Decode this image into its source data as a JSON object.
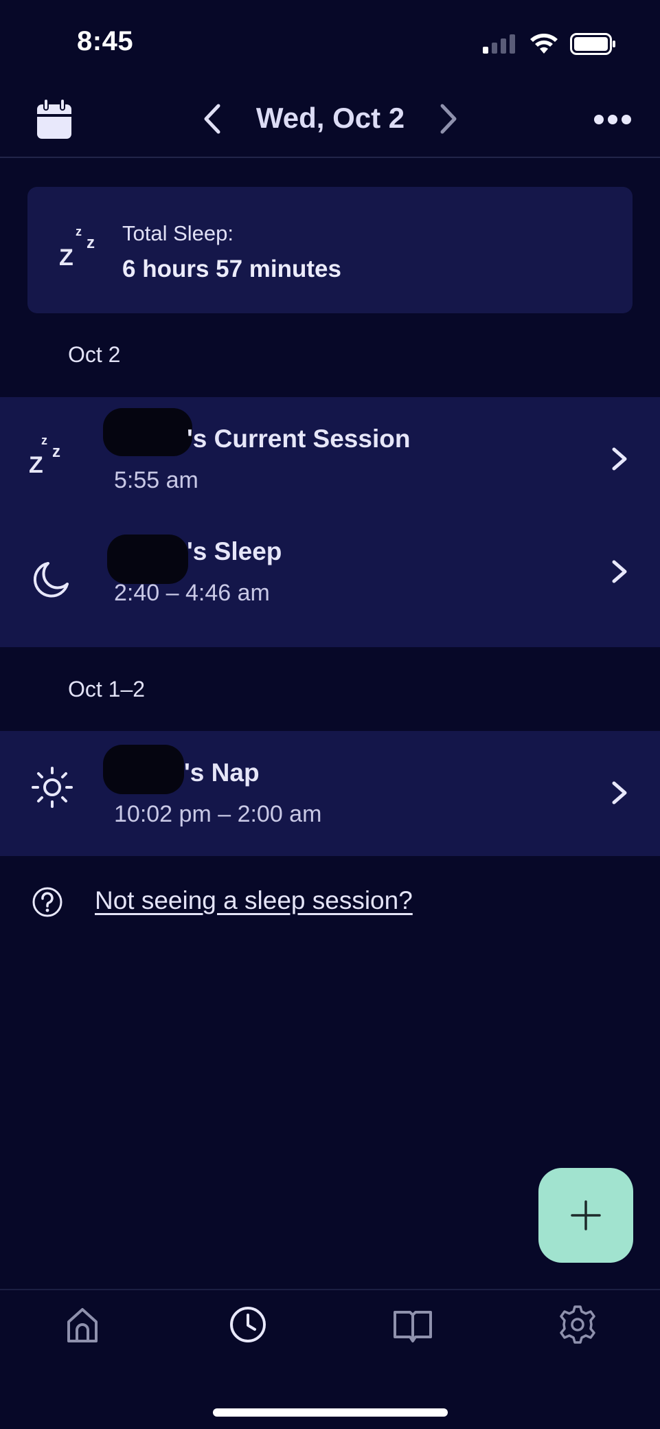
{
  "status_bar": {
    "time": "8:45"
  },
  "header": {
    "date_title": "Wed, Oct 2",
    "icons": {
      "calendar": "calendar-icon",
      "prev": "chevron-left-icon",
      "next": "chevron-right-icon",
      "more": "more-dots-icon"
    }
  },
  "summary": {
    "label": "Total Sleep:",
    "value": "6 hours 57 minutes",
    "icon": "zzz-icon"
  },
  "sections": [
    {
      "header": "Oct 2",
      "sessions": [
        {
          "title": "'s Current Session",
          "time": "5:55 am",
          "icon": "zzz-icon"
        },
        {
          "title": "'s Sleep",
          "time": "2:40 – 4:46 am",
          "icon": "moon-icon"
        }
      ]
    },
    {
      "header": "Oct 1–2",
      "sessions": [
        {
          "title": "'s Nap",
          "time": "10:02 pm – 2:00 am",
          "icon": "sun-icon"
        }
      ]
    }
  ],
  "help": {
    "link_text": "Not seeing a sleep session?",
    "icon": "question-icon"
  },
  "fab": {
    "icon": "plus-icon"
  },
  "tabs": [
    {
      "icon": "home-icon"
    },
    {
      "icon": "clock-icon"
    },
    {
      "icon": "book-icon"
    },
    {
      "icon": "gear-icon"
    }
  ],
  "colors": {
    "background": "#070828",
    "card": "#15174a",
    "accent": "#a1e3cf"
  }
}
